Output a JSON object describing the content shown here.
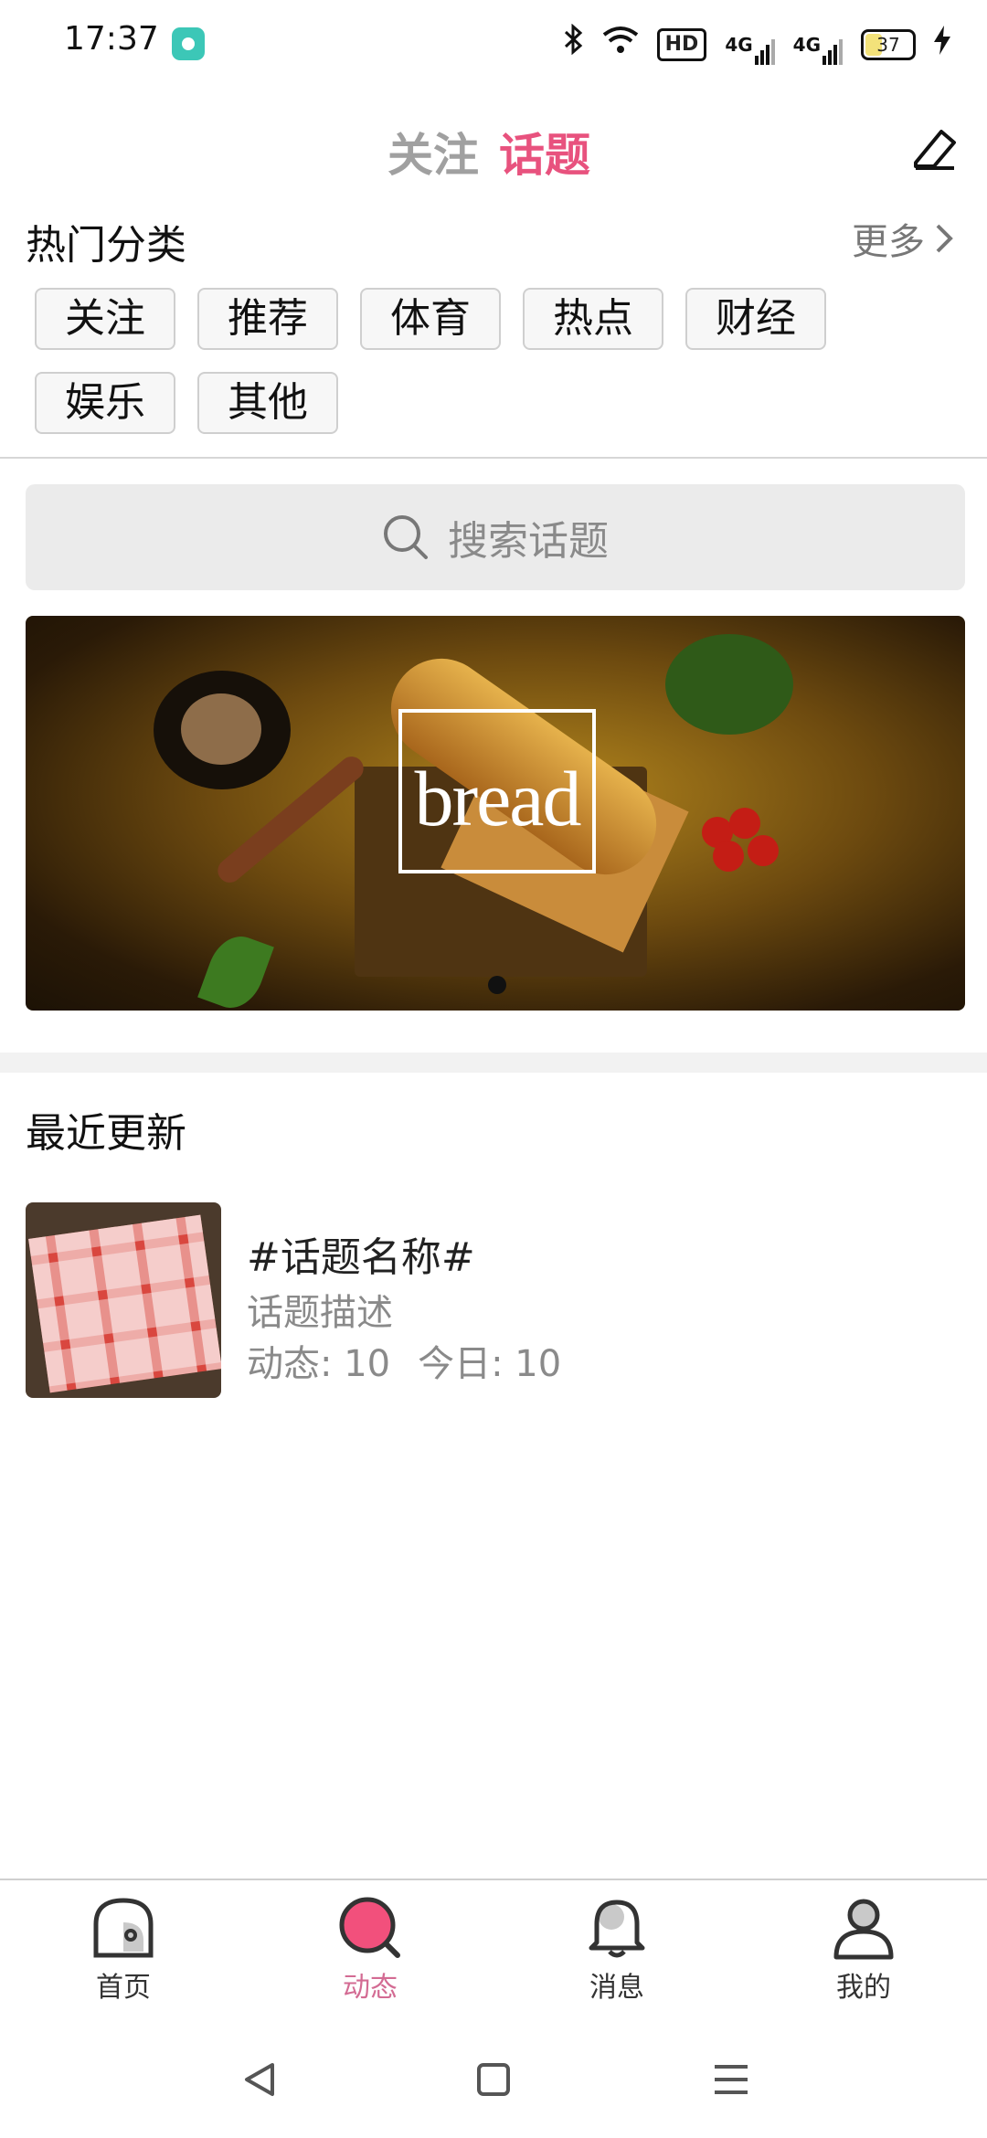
{
  "status_bar": {
    "time": "17:37",
    "icons": [
      "app-icon",
      "bluetooth-icon",
      "wifi-icon",
      "hd-icon",
      "signal-4g-icon",
      "signal-4g-icon",
      "battery-icon",
      "charging-icon"
    ],
    "hd_label": "HD",
    "net1": "4G",
    "net2": "4G",
    "battery": "37",
    "battery_level": 0.37
  },
  "header": {
    "tabs": [
      {
        "label": "关注",
        "active": false
      },
      {
        "label": "话题",
        "active": true
      }
    ],
    "accent_color": "#e8527e"
  },
  "hot_categories": {
    "title": "热门分类",
    "more_label": "更多",
    "chips": [
      "关注",
      "推荐",
      "体育",
      "热点",
      "财经",
      "娱乐",
      "其他"
    ]
  },
  "search": {
    "placeholder": "搜索话题"
  },
  "banner": {
    "word": "bread"
  },
  "recent": {
    "title": "最近更新",
    "items": [
      {
        "name": "#话题名称#",
        "description": "话题描述",
        "stat_dynamic": "动态: 10",
        "stat_today": "今日: 10"
      }
    ]
  },
  "bottom_nav": {
    "items": [
      {
        "label": "首页",
        "icon": "home-icon",
        "active": false
      },
      {
        "label": "动态",
        "icon": "dynamic-icon",
        "active": true
      },
      {
        "label": "消息",
        "icon": "bell-icon",
        "active": false
      },
      {
        "label": "我的",
        "icon": "profile-icon",
        "active": false
      }
    ],
    "active_color": "#d36b93"
  }
}
